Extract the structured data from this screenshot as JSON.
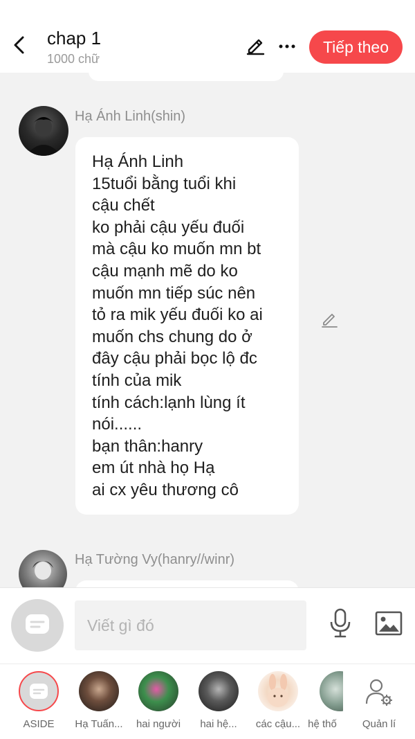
{
  "header": {
    "back_icon": "chevron-left-icon",
    "title": "chap 1",
    "subtitle": "1000 chữ",
    "edit_icon": "pencil-icon",
    "more_icon": "more-dots-icon",
    "next_label": "Tiếp theo",
    "accent_color": "#f6484b"
  },
  "messages": [
    {
      "sender": "Hạ Ánh Linh(shin)",
      "avatar": "avatar-dark-character",
      "lines": [
        "Hạ Ánh Linh",
        "15tuổi bằng tuổi khi",
        "cậu chết",
        "ko phải cậu yếu đuối",
        "mà cậu ko muốn mn bt",
        "cậu mạnh mẽ do ko",
        "muốn mn tiếp súc nên",
        "tỏ ra mik yếu đuối ko ai",
        "muốn chs chung do ở",
        "đây cậu phải bọc lộ đc",
        "tính của mik",
        "tính cách:lạnh lùng ít",
        "nói......",
        "bạn thân:hanry",
        "em út nhà họ Hạ",
        "ai cx yêu thương cô"
      ]
    },
    {
      "sender": "Hạ Tường Vy(hanry//winr)",
      "avatar": "avatar-character"
    }
  ],
  "input": {
    "placeholder": "Viết gì đó",
    "aside_icon": "aside-chat-icon",
    "mic_icon": "microphone-icon",
    "image_icon": "image-icon"
  },
  "characters": [
    {
      "label": "ASIDE",
      "selected": true
    },
    {
      "label": "Hạ Tuấn..."
    },
    {
      "label": "hai người"
    },
    {
      "label": "hai hệ..."
    },
    {
      "label": "các cậu..."
    },
    {
      "label": "hệ thố"
    },
    {
      "label": "Quản lí",
      "icon": "user-settings-icon"
    }
  ]
}
